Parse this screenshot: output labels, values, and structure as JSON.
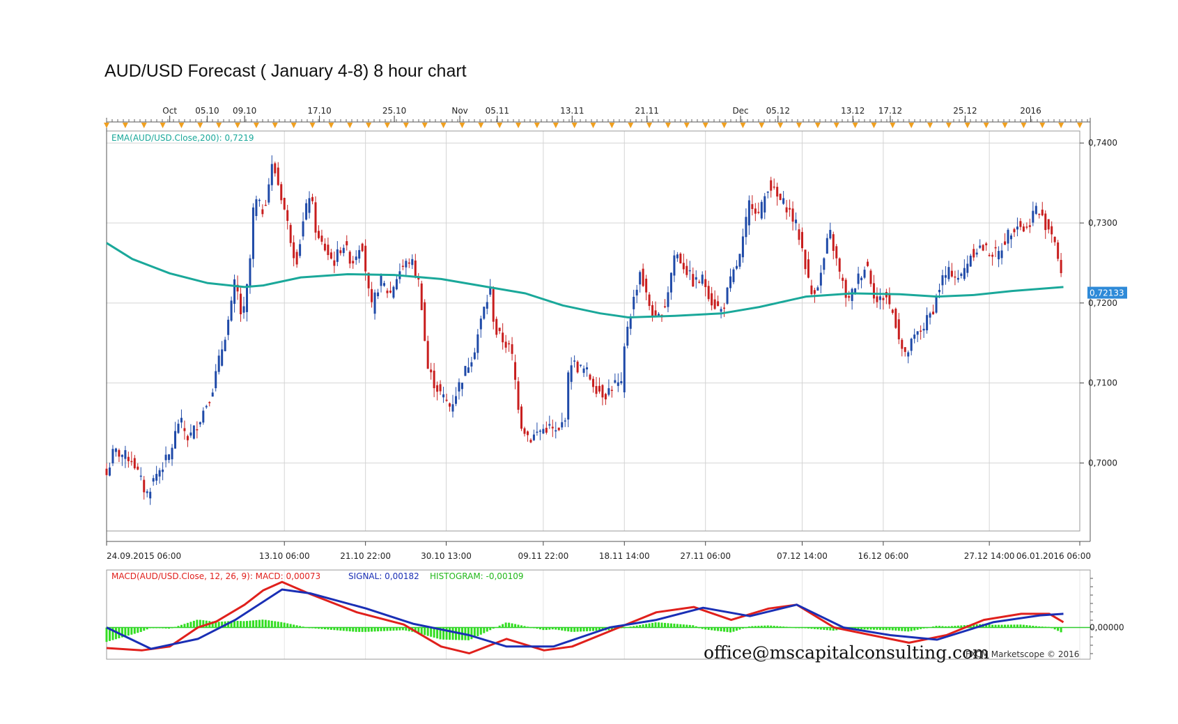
{
  "title": "AUD/USD Forecast ( January 4-8) 8 hour chart",
  "watermark": "office@mscapitalconsulting.com",
  "copyright": "FXCM Marketscope © 2016",
  "colors": {
    "bull": "#1f4aa8",
    "bear": "#c81e1e",
    "ema": "#1aa89a",
    "macd": "#e0201c",
    "signal": "#1a2fb5",
    "histogram": "#33dd22",
    "grid": "#d4d4d4",
    "marker": "#f0a020",
    "price_label_bg": "#2e8ad8"
  },
  "chart_data": [
    {
      "type": "candlestick",
      "instrument": "AUD/USD",
      "timeframe": "8 hour",
      "indicator_label": "EMA(AUD/USD.Close,200): 0,7219",
      "ylim": [
        0.6915,
        0.7415
      ],
      "xlim": [
        "2015-09-24 06:00",
        "2016-01-06 06:00"
      ],
      "y_ticks": [
        "0,7400",
        "0,7300",
        "0,7200",
        "0,7100",
        "0,7000"
      ],
      "y_tick_values": [
        0.74,
        0.73,
        0.72,
        0.71,
        0.7
      ],
      "last_price_label": "0,72133",
      "last_price": 0.72133,
      "top_axis_labels": [
        {
          "t": "2015-10-01 00:00",
          "label": "Oct"
        },
        {
          "t": "2015-10-05 00:00",
          "label": "05.10"
        },
        {
          "t": "2015-10-09 00:00",
          "label": "09.10"
        },
        {
          "t": "2015-10-17 00:00",
          "label": "17.10"
        },
        {
          "t": "2015-10-25 00:00",
          "label": "25.10"
        },
        {
          "t": "2015-11-01 00:00",
          "label": "Nov"
        },
        {
          "t": "2015-11-05 00:00",
          "label": "05.11"
        },
        {
          "t": "2015-11-13 00:00",
          "label": "13.11"
        },
        {
          "t": "2015-11-21 00:00",
          "label": "21.11"
        },
        {
          "t": "2015-12-01 00:00",
          "label": "Dec"
        },
        {
          "t": "2015-12-05 00:00",
          "label": "05.12"
        },
        {
          "t": "2015-12-13 00:00",
          "label": "13.12"
        },
        {
          "t": "2015-12-17 00:00",
          "label": "17.12"
        },
        {
          "t": "2015-12-25 00:00",
          "label": "25.12"
        },
        {
          "t": "2016-01-01 00:00",
          "label": "2016"
        }
      ],
      "bottom_axis_labels": [
        {
          "t": "2015-09-24 06:00",
          "label": "24.09.2015 06:00"
        },
        {
          "t": "2015-10-13 06:00",
          "label": "13.10 06:00"
        },
        {
          "t": "2015-10-21 22:00",
          "label": "21.10 22:00"
        },
        {
          "t": "2015-10-30 13:00",
          "label": "30.10 13:00"
        },
        {
          "t": "2015-11-09 22:00",
          "label": "09.11 22:00"
        },
        {
          "t": "2015-11-18 14:00",
          "label": "18.11 14:00"
        },
        {
          "t": "2015-11-27 06:00",
          "label": "27.11 06:00"
        },
        {
          "t": "2015-12-07 14:00",
          "label": "07.12 14:00"
        },
        {
          "t": "2015-12-16 06:00",
          "label": "16.12 06:00"
        },
        {
          "t": "2015-12-27 14:00",
          "label": "27.12 14:00"
        },
        {
          "t": "2016-01-06 06:00",
          "label": "06.01.2016 06:00"
        }
      ],
      "close_path": [
        [
          "2015-09-24 06:00",
          0.6985
        ],
        [
          "2015-09-25 00:00",
          0.7015
        ],
        [
          "2015-09-27 00:00",
          0.7005
        ],
        [
          "2015-09-28 12:00",
          0.696
        ],
        [
          "2015-09-29 12:00",
          0.6985
        ],
        [
          "2015-10-01 00:00",
          0.701
        ],
        [
          "2015-10-02 00:00",
          0.7055
        ],
        [
          "2015-10-03 00:00",
          0.703
        ],
        [
          "2015-10-04 00:00",
          0.705
        ],
        [
          "2015-10-05 12:00",
          0.709
        ],
        [
          "2015-10-06 12:00",
          0.714
        ],
        [
          "2015-10-07 12:00",
          0.719
        ],
        [
          "2015-10-08 00:00",
          0.723
        ],
        [
          "2015-10-08 18:00",
          0.7175
        ],
        [
          "2015-10-09 12:00",
          0.724
        ],
        [
          "2015-10-10 00:00",
          0.733
        ],
        [
          "2015-10-11 00:00",
          0.7315
        ],
        [
          "2015-10-12 00:00",
          0.7375
        ],
        [
          "2015-10-13 00:00",
          0.733
        ],
        [
          "2015-10-13 18:00",
          0.729
        ],
        [
          "2015-10-14 12:00",
          0.725
        ],
        [
          "2015-10-15 06:00",
          0.73
        ],
        [
          "2015-10-16 00:00",
          0.734
        ],
        [
          "2015-10-16 18:00",
          0.728
        ],
        [
          "2015-10-17 12:00",
          0.727
        ],
        [
          "2015-10-18 12:00",
          0.725
        ],
        [
          "2015-10-19 12:00",
          0.7275
        ],
        [
          "2015-10-20 12:00",
          0.725
        ],
        [
          "2015-10-21 12:00",
          0.728
        ],
        [
          "2015-10-22 12:00",
          0.719
        ],
        [
          "2015-10-23 12:00",
          0.723
        ],
        [
          "2015-10-24 12:00",
          0.721
        ],
        [
          "2015-10-25 12:00",
          0.724
        ],
        [
          "2015-10-26 18:00",
          0.7255
        ],
        [
          "2015-10-27 18:00",
          0.722
        ],
        [
          "2015-10-28 12:00",
          0.712
        ],
        [
          "2015-10-29 06:00",
          0.71
        ],
        [
          "2015-10-30 00:00",
          0.7085
        ],
        [
          "2015-10-31 00:00",
          0.707
        ],
        [
          "2015-11-01 00:00",
          0.71
        ],
        [
          "2015-11-02 12:00",
          0.714
        ],
        [
          "2015-11-03 12:00",
          0.719
        ],
        [
          "2015-11-04 06:00",
          0.7215
        ],
        [
          "2015-11-04 18:00",
          0.7165
        ],
        [
          "2015-11-05 12:00",
          0.7155
        ],
        [
          "2015-11-06 12:00",
          0.714
        ],
        [
          "2015-11-07 12:00",
          0.705
        ],
        [
          "2015-11-08 12:00",
          0.703
        ],
        [
          "2015-11-09 12:00",
          0.704
        ],
        [
          "2015-11-10 12:00",
          0.7045
        ],
        [
          "2015-11-11 12:00",
          0.7035
        ],
        [
          "2015-11-12 06:00",
          0.706
        ],
        [
          "2015-11-12 18:00",
          0.713
        ],
        [
          "2015-11-13 12:00",
          0.712
        ],
        [
          "2015-11-14 12:00",
          0.7115
        ],
        [
          "2015-11-15 12:00",
          0.7095
        ],
        [
          "2015-11-16 12:00",
          0.7085
        ],
        [
          "2015-11-17 12:00",
          0.71
        ],
        [
          "2015-11-18 06:00",
          0.7095
        ],
        [
          "2015-11-18 18:00",
          0.7165
        ],
        [
          "2015-11-19 12:00",
          0.72
        ],
        [
          "2015-11-20 06:00",
          0.724
        ],
        [
          "2015-11-21 00:00",
          0.7205
        ],
        [
          "2015-11-22 00:00",
          0.7175
        ],
        [
          "2015-11-23 00:00",
          0.72
        ],
        [
          "2015-11-24 00:00",
          0.7265
        ],
        [
          "2015-11-25 00:00",
          0.7245
        ],
        [
          "2015-11-26 00:00",
          0.7225
        ],
        [
          "2015-11-27 00:00",
          0.723
        ],
        [
          "2015-11-28 00:00",
          0.72
        ],
        [
          "2015-11-29 00:00",
          0.719
        ],
        [
          "2015-11-30 00:00",
          0.723
        ],
        [
          "2015-12-01 00:00",
          0.726
        ],
        [
          "2015-12-02 00:00",
          0.733
        ],
        [
          "2015-12-03 00:00",
          0.731
        ],
        [
          "2015-12-04 00:00",
          0.735
        ],
        [
          "2015-12-05 00:00",
          0.733
        ],
        [
          "2015-12-06 00:00",
          0.732
        ],
        [
          "2015-12-07 00:00",
          0.7295
        ],
        [
          "2015-12-07 18:00",
          0.726
        ],
        [
          "2015-12-08 12:00",
          0.721
        ],
        [
          "2015-12-09 12:00",
          0.723
        ],
        [
          "2015-12-10 12:00",
          0.729
        ],
        [
          "2015-12-11 12:00",
          0.724
        ],
        [
          "2015-12-12 12:00",
          0.72
        ],
        [
          "2015-12-13 12:00",
          0.723
        ],
        [
          "2015-12-14 12:00",
          0.725
        ],
        [
          "2015-12-15 12:00",
          0.72
        ],
        [
          "2015-12-16 12:00",
          0.721
        ],
        [
          "2015-12-17 12:00",
          0.718
        ],
        [
          "2015-12-18 12:00",
          0.713
        ],
        [
          "2015-12-19 12:00",
          0.7155
        ],
        [
          "2015-12-20 12:00",
          0.717
        ],
        [
          "2015-12-21 12:00",
          0.719
        ],
        [
          "2015-12-22 12:00",
          0.723
        ],
        [
          "2015-12-23 12:00",
          0.724
        ],
        [
          "2015-12-24 12:00",
          0.723
        ],
        [
          "2015-12-25 12:00",
          0.726
        ],
        [
          "2015-12-26 12:00",
          0.727
        ],
        [
          "2015-12-27 12:00",
          0.7265
        ],
        [
          "2015-12-28 12:00",
          0.726
        ],
        [
          "2015-12-29 12:00",
          0.7285
        ],
        [
          "2015-12-30 12:00",
          0.73
        ],
        [
          "2015-12-31 12:00",
          0.729
        ],
        [
          "2016-01-01 12:00",
          0.732
        ],
        [
          "2016-01-02 12:00",
          0.73
        ],
        [
          "2016-01-03 12:00",
          0.7285
        ],
        [
          "2016-01-04 12:00",
          0.7213
        ]
      ],
      "ema_200": [
        [
          "2015-09-24 06:00",
          0.7275
        ],
        [
          "2015-09-27 00:00",
          0.7255
        ],
        [
          "2015-10-01 00:00",
          0.7237
        ],
        [
          "2015-10-05 00:00",
          0.7225
        ],
        [
          "2015-10-09 00:00",
          0.722
        ],
        [
          "2015-10-11 00:00",
          0.7222
        ],
        [
          "2015-10-15 00:00",
          0.7232
        ],
        [
          "2015-10-20 00:00",
          0.7236
        ],
        [
          "2015-10-25 00:00",
          0.7235
        ],
        [
          "2015-10-30 00:00",
          0.723
        ],
        [
          "2015-11-04 00:00",
          0.722
        ],
        [
          "2015-11-08 00:00",
          0.7212
        ],
        [
          "2015-11-12 00:00",
          0.7197
        ],
        [
          "2015-11-16 00:00",
          0.7187
        ],
        [
          "2015-11-19 00:00",
          0.7182
        ],
        [
          "2015-11-24 00:00",
          0.7184
        ],
        [
          "2015-11-29 00:00",
          0.7187
        ],
        [
          "2015-12-03 00:00",
          0.7195
        ],
        [
          "2015-12-08 00:00",
          0.7208
        ],
        [
          "2015-12-13 00:00",
          0.7212
        ],
        [
          "2015-12-18 00:00",
          0.7211
        ],
        [
          "2015-12-22 00:00",
          0.7208
        ],
        [
          "2015-12-26 00:00",
          0.721
        ],
        [
          "2015-12-30 00:00",
          0.7215
        ],
        [
          "2016-01-04 12:00",
          0.722
        ]
      ]
    },
    {
      "type": "line",
      "indicator": "MACD",
      "legend": [
        {
          "key": "macd",
          "text": "MACD(AUD/USD.Close, 12, 26, 9): MACD: 0,00073"
        },
        {
          "key": "signal",
          "text": "SIGNAL: 0,00182"
        },
        {
          "key": "histogram",
          "text": "HISTOGRAM: -0,00109"
        }
      ],
      "y_ticks": [
        "0,00000"
      ],
      "y_tick_values": [
        0
      ],
      "ylim": [
        -0.0038,
        0.0072
      ],
      "series": [
        {
          "key": "macd",
          "points": [
            [
              "2015-09-24 06:00",
              -0.0027
            ],
            [
              "2015-09-28 00:00",
              -0.003
            ],
            [
              "2015-10-01 00:00",
              -0.0025
            ],
            [
              "2015-10-04 00:00",
              0.0
            ],
            [
              "2015-10-06 00:00",
              0.0008
            ],
            [
              "2015-10-09 00:00",
              0.003
            ],
            [
              "2015-10-11 00:00",
              0.0049
            ],
            [
              "2015-10-13 00:00",
              0.006
            ],
            [
              "2015-10-16 00:00",
              0.0044
            ],
            [
              "2015-10-21 00:00",
              0.002
            ],
            [
              "2015-10-26 00:00",
              0.0004
            ],
            [
              "2015-10-30 00:00",
              -0.0025
            ],
            [
              "2015-11-02 00:00",
              -0.0034
            ],
            [
              "2015-11-06 00:00",
              -0.0015
            ],
            [
              "2015-11-10 00:00",
              -0.003
            ],
            [
              "2015-11-13 00:00",
              -0.0025
            ],
            [
              "2015-11-18 00:00",
              0.0
            ],
            [
              "2015-11-22 00:00",
              0.002
            ],
            [
              "2015-11-26 00:00",
              0.0027
            ],
            [
              "2015-11-30 00:00",
              0.001
            ],
            [
              "2015-12-04 00:00",
              0.0025
            ],
            [
              "2015-12-07 00:00",
              0.003
            ],
            [
              "2015-12-11 00:00",
              0.0
            ],
            [
              "2015-12-15 00:00",
              -0.001
            ],
            [
              "2015-12-19 00:00",
              -0.002
            ],
            [
              "2015-12-23 00:00",
              -0.001
            ],
            [
              "2015-12-27 00:00",
              0.001
            ],
            [
              "2015-12-31 00:00",
              0.0018
            ],
            [
              "2016-01-03 00:00",
              0.0018
            ],
            [
              "2016-01-04 12:00",
              0.0007
            ]
          ]
        },
        {
          "key": "signal",
          "points": [
            [
              "2015-09-24 06:00",
              0.0
            ],
            [
              "2015-09-29 00:00",
              -0.0028
            ],
            [
              "2015-10-04 00:00",
              -0.0015
            ],
            [
              "2015-10-08 00:00",
              0.001
            ],
            [
              "2015-10-13 00:00",
              0.005
            ],
            [
              "2015-10-16 00:00",
              0.0045
            ],
            [
              "2015-10-22 00:00",
              0.0025
            ],
            [
              "2015-10-27 00:00",
              0.0005
            ],
            [
              "2015-11-02 00:00",
              -0.001
            ],
            [
              "2015-11-06 00:00",
              -0.0025
            ],
            [
              "2015-11-11 00:00",
              -0.0025
            ],
            [
              "2015-11-17 00:00",
              0.0
            ],
            [
              "2015-11-22 00:00",
              0.001
            ],
            [
              "2015-11-27 00:00",
              0.0026
            ],
            [
              "2015-12-02 00:00",
              0.0015
            ],
            [
              "2015-12-07 00:00",
              0.003
            ],
            [
              "2015-12-12 00:00",
              0.0
            ],
            [
              "2015-12-17 00:00",
              -0.001
            ],
            [
              "2015-12-22 00:00",
              -0.0016
            ],
            [
              "2015-12-28 00:00",
              0.0007
            ],
            [
              "2016-01-02 00:00",
              0.0016
            ],
            [
              "2016-01-04 12:00",
              0.0018
            ]
          ]
        }
      ]
    }
  ]
}
